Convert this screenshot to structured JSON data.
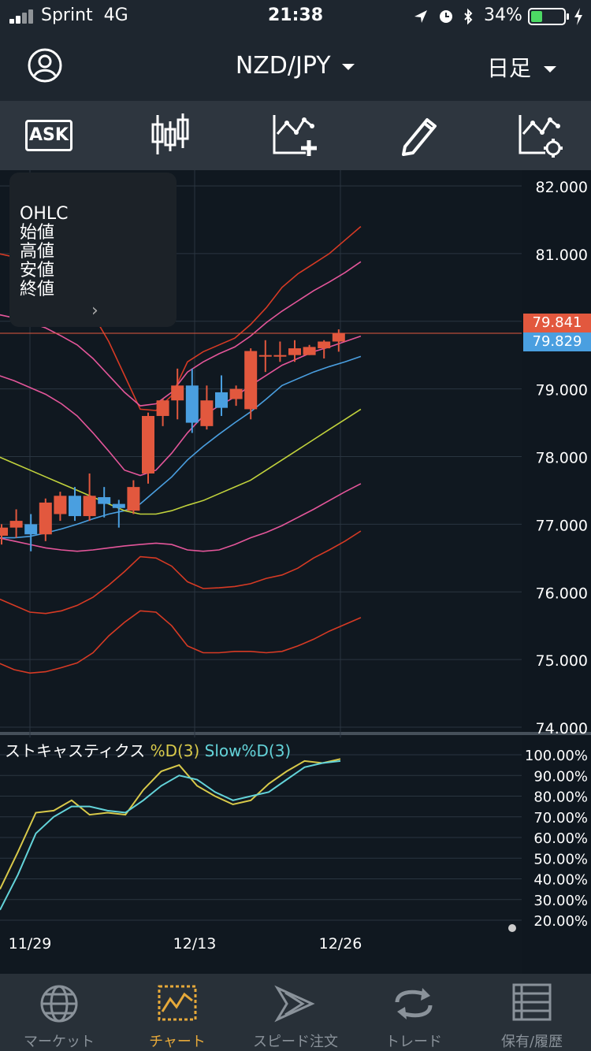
{
  "status_bar": {
    "carrier": "Sprint",
    "network": "4G",
    "time": "21:38",
    "battery_percent": "34%",
    "battery_level": 0.34,
    "icons": [
      "location-icon",
      "alarm-icon",
      "bluetooth-icon",
      "charging-icon"
    ]
  },
  "header": {
    "pair": "NZD/JPY",
    "timeframe": "日足"
  },
  "toolbar": {
    "ask_label": "ASK",
    "tools": [
      "ask-toggle",
      "candlestick-icon",
      "add-indicator-icon",
      "draw-icon",
      "chart-settings-icon"
    ]
  },
  "ohlc_panel": {
    "title": "OHLC",
    "open": "始値",
    "high": "高値",
    "low": "安値",
    "close": "終値"
  },
  "price_tags": {
    "ask": "79.841",
    "bid": "79.829",
    "ask_color": "#e2583e",
    "bid_color": "#4a9fe0"
  },
  "stoch_legend": {
    "name": "ストキャスティクス",
    "d_label": "%D(3)",
    "slow_label": "Slow%D(3)",
    "d_color": "#d8c94a",
    "slow_color": "#63d3d9"
  },
  "chart_data": [
    {
      "type": "candlestick",
      "y_ticks": [
        "82.000",
        "81.000",
        "79.000",
        "78.000",
        "77.000",
        "76.000",
        "75.000",
        "74.000"
      ],
      "ylim": [
        74.0,
        82.2
      ],
      "x_ticks": [
        "11/29",
        "12/13",
        "12/26"
      ],
      "colors": {
        "up": "#e2583e",
        "down": "#4a9fe0"
      },
      "candles": [
        {
          "o": 76.83,
          "h": 77.0,
          "l": 76.7,
          "c": 76.95
        },
        {
          "o": 76.95,
          "h": 77.22,
          "l": 76.8,
          "c": 77.05
        },
        {
          "o": 77.0,
          "h": 77.15,
          "l": 76.6,
          "c": 76.85
        },
        {
          "o": 76.85,
          "h": 77.38,
          "l": 76.75,
          "c": 77.32
        },
        {
          "o": 77.15,
          "h": 77.48,
          "l": 77.05,
          "c": 77.42
        },
        {
          "o": 77.42,
          "h": 77.55,
          "l": 77.05,
          "c": 77.12
        },
        {
          "o": 77.12,
          "h": 77.75,
          "l": 77.05,
          "c": 77.42
        },
        {
          "o": 77.4,
          "h": 77.55,
          "l": 77.1,
          "c": 77.3
        },
        {
          "o": 77.3,
          "h": 77.36,
          "l": 76.95,
          "c": 77.24
        },
        {
          "o": 77.2,
          "h": 77.65,
          "l": 77.15,
          "c": 77.55
        },
        {
          "o": 77.75,
          "h": 78.65,
          "l": 77.6,
          "c": 78.6
        },
        {
          "o": 78.6,
          "h": 78.85,
          "l": 78.45,
          "c": 78.83
        },
        {
          "o": 78.83,
          "h": 79.3,
          "l": 78.55,
          "c": 79.05
        },
        {
          "o": 79.05,
          "h": 79.3,
          "l": 78.35,
          "c": 78.5
        },
        {
          "o": 78.45,
          "h": 79.05,
          "l": 78.4,
          "c": 78.83
        },
        {
          "o": 78.95,
          "h": 79.2,
          "l": 78.6,
          "c": 78.72
        },
        {
          "o": 78.85,
          "h": 79.05,
          "l": 78.75,
          "c": 79.0
        },
        {
          "o": 78.7,
          "h": 79.6,
          "l": 78.55,
          "c": 79.56
        },
        {
          "o": 79.5,
          "h": 79.72,
          "l": 79.25,
          "c": 79.5
        },
        {
          "o": 79.5,
          "h": 79.7,
          "l": 79.4,
          "c": 79.5
        },
        {
          "o": 79.5,
          "h": 79.72,
          "l": 79.4,
          "c": 79.6
        },
        {
          "o": 79.5,
          "h": 79.65,
          "l": 79.5,
          "c": 79.62
        },
        {
          "o": 79.6,
          "h": 79.72,
          "l": 79.45,
          "c": 79.7
        },
        {
          "o": 79.7,
          "h": 79.88,
          "l": 79.55,
          "c": 79.82
        }
      ],
      "lines": [
        {
          "color": "#d63a24",
          "values": [
            81.0,
            80.95,
            80.88,
            80.78,
            80.6,
            80.4,
            80.1,
            79.7,
            79.2,
            78.7,
            78.68,
            78.9,
            79.4,
            79.55,
            79.65,
            79.75,
            79.95,
            80.2,
            80.5,
            80.7,
            80.85,
            81.0,
            81.2,
            81.4
          ]
        },
        {
          "color": "#e4569a",
          "values": [
            80.1,
            80.05,
            79.98,
            79.9,
            79.78,
            79.65,
            79.45,
            79.2,
            78.95,
            78.75,
            78.78,
            78.95,
            79.25,
            79.4,
            79.52,
            79.62,
            79.78,
            79.98,
            80.15,
            80.3,
            80.45,
            80.58,
            80.72,
            80.88
          ]
        },
        {
          "color": "#e4569a",
          "values": [
            79.2,
            79.12,
            79.02,
            78.92,
            78.78,
            78.6,
            78.35,
            78.08,
            77.8,
            77.72,
            77.8,
            78.05,
            78.35,
            78.6,
            78.75,
            78.88,
            79.05,
            79.2,
            79.35,
            79.45,
            79.55,
            79.62,
            79.7,
            79.78
          ]
        },
        {
          "color": "#4a9fe0",
          "values": [
            76.8,
            76.8,
            76.82,
            76.87,
            76.93,
            77.0,
            77.08,
            77.15,
            77.2,
            77.3,
            77.5,
            77.7,
            77.95,
            78.15,
            78.33,
            78.5,
            78.66,
            78.85,
            79.05,
            79.15,
            79.25,
            79.33,
            79.4,
            79.48
          ]
        },
        {
          "color": "#c1d23c",
          "values": [
            78.0,
            77.9,
            77.8,
            77.7,
            77.6,
            77.5,
            77.4,
            77.3,
            77.2,
            77.15,
            77.15,
            77.2,
            77.28,
            77.35,
            77.45,
            77.55,
            77.65,
            77.8,
            77.95,
            78.1,
            78.25,
            78.4,
            78.55,
            78.7
          ]
        },
        {
          "color": "#e4569a",
          "values": [
            76.8,
            76.75,
            76.7,
            76.65,
            76.62,
            76.6,
            76.62,
            76.65,
            76.68,
            76.7,
            76.72,
            76.7,
            76.62,
            76.6,
            76.62,
            76.7,
            76.8,
            76.88,
            76.98,
            77.1,
            77.22,
            77.35,
            77.48,
            77.6
          ]
        },
        {
          "color": "#d63a24",
          "values": [
            75.9,
            75.8,
            75.7,
            75.68,
            75.72,
            75.8,
            75.92,
            76.1,
            76.3,
            76.52,
            76.5,
            76.38,
            76.15,
            76.05,
            76.06,
            76.08,
            76.12,
            76.2,
            76.25,
            76.35,
            76.5,
            76.62,
            76.75,
            76.9
          ]
        },
        {
          "color": "#d63a24",
          "values": [
            74.95,
            74.85,
            74.8,
            74.82,
            74.88,
            74.95,
            75.1,
            75.35,
            75.55,
            75.72,
            75.7,
            75.5,
            75.2,
            75.1,
            75.1,
            75.12,
            75.12,
            75.1,
            75.12,
            75.2,
            75.3,
            75.42,
            75.52,
            75.62
          ]
        }
      ]
    },
    {
      "type": "line",
      "title": "ストキャスティクス",
      "y_ticks": [
        "100.00%",
        "90.00%",
        "80.00%",
        "70.00%",
        "60.00%",
        "50.00%",
        "40.00%",
        "30.00%",
        "20.00%"
      ],
      "ylim": [
        20,
        100
      ],
      "series": [
        {
          "name": "%D(3)",
          "color": "#d8c94a",
          "values": [
            35,
            53,
            72,
            73,
            78,
            71,
            72,
            71,
            83,
            92,
            95,
            85,
            80,
            76,
            78,
            86,
            92,
            97,
            96,
            98
          ]
        },
        {
          "name": "Slow%D(3)",
          "color": "#63d3d9",
          "values": [
            25,
            42,
            62,
            70,
            75,
            75,
            73,
            72,
            78,
            85,
            90,
            88,
            82,
            78,
            80,
            82,
            88,
            94,
            96,
            97
          ]
        }
      ]
    }
  ],
  "tabs": [
    {
      "label": "マーケット",
      "icon": "globe-icon"
    },
    {
      "label": "チャート",
      "icon": "chart-icon",
      "active": true
    },
    {
      "label": "スピード注文",
      "icon": "speed-order-icon"
    },
    {
      "label": "トレード",
      "icon": "trade-icon"
    },
    {
      "label": "保有/履歴",
      "icon": "history-icon"
    }
  ]
}
